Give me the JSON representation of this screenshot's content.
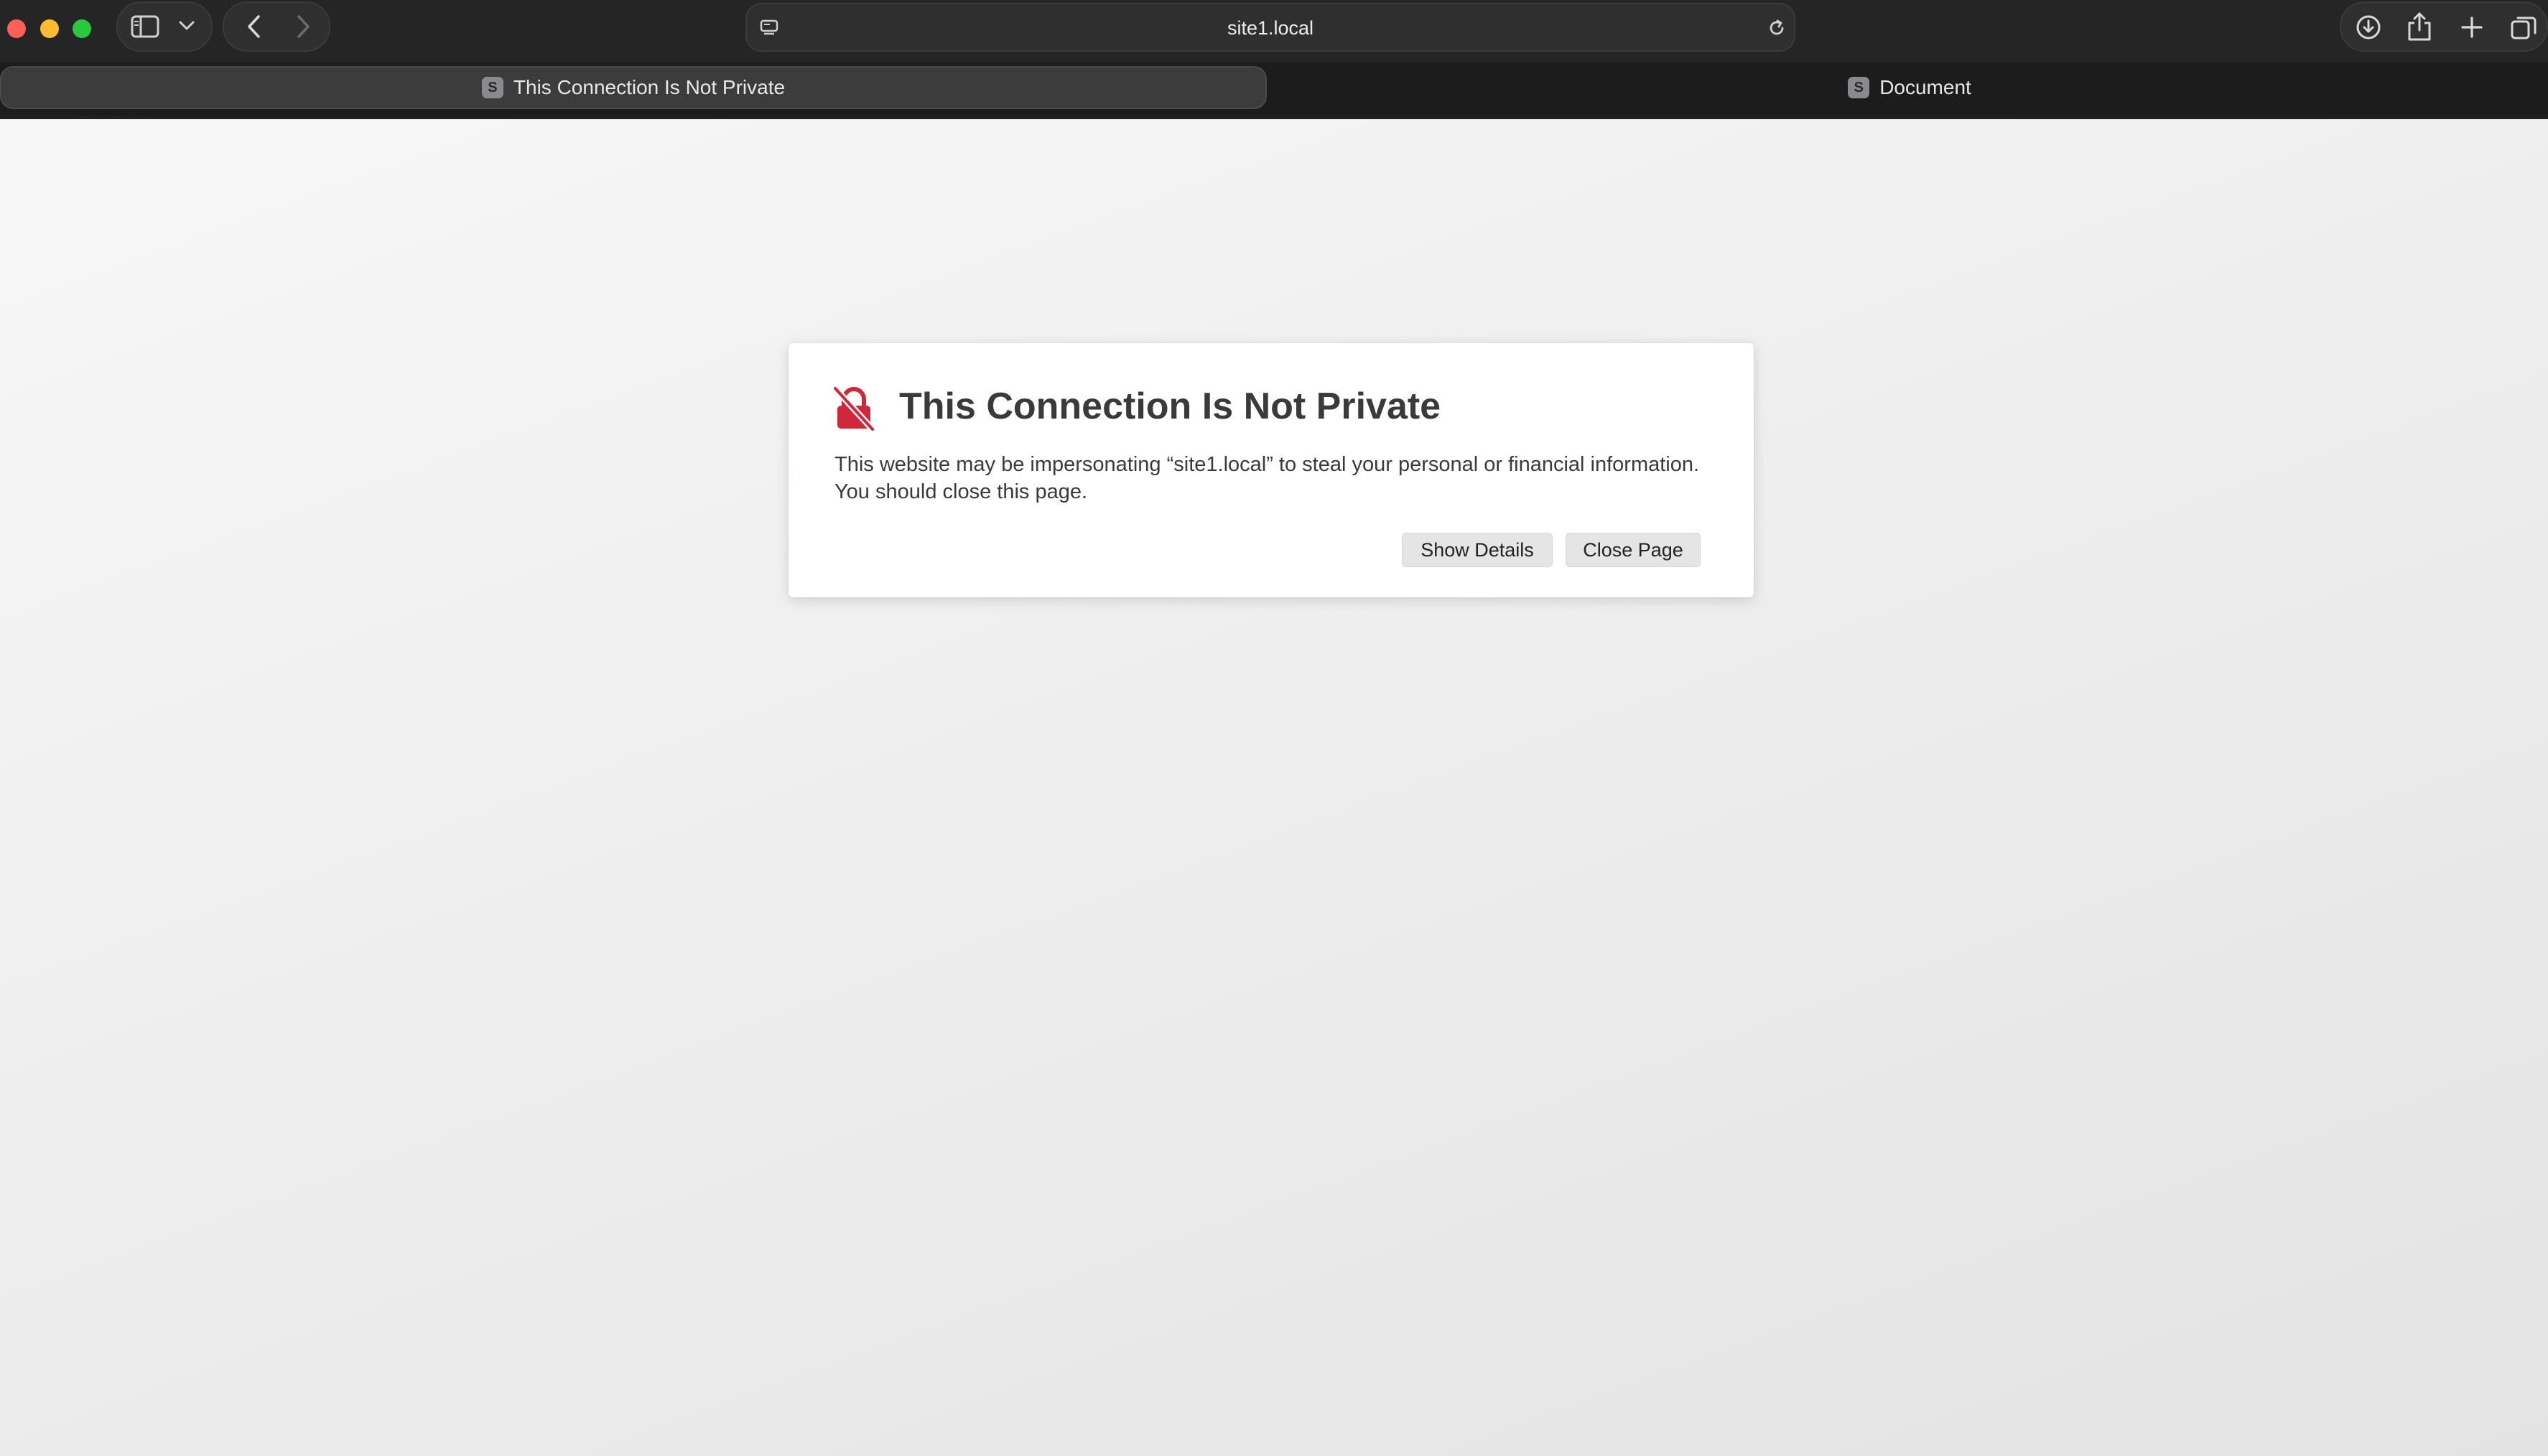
{
  "browser": {
    "address": "site1.local",
    "tabs": [
      {
        "label": "This Connection Is Not Private",
        "favicon": "S",
        "active": true
      },
      {
        "label": "Document",
        "favicon": "S",
        "active": false
      }
    ],
    "icons": {
      "sidebar": "sidebar-icon",
      "chevron": "chevron-down-icon",
      "back": "back-icon",
      "forward": "forward-icon",
      "page_settings": "page-settings-icon",
      "reload": "reload-icon",
      "downloads": "download-icon",
      "share": "share-icon",
      "new_tab": "plus-icon",
      "tab_overview": "tab-overview-icon"
    }
  },
  "warning": {
    "title": "This Connection Is Not Private",
    "body": "This website may be impersonating “site1.local” to steal your personal or financial information. You should close this page.",
    "show_details_label": "Show Details",
    "close_page_label": "Close Page",
    "icon": "broken-lock-icon",
    "icon_color": "#d0273a"
  }
}
